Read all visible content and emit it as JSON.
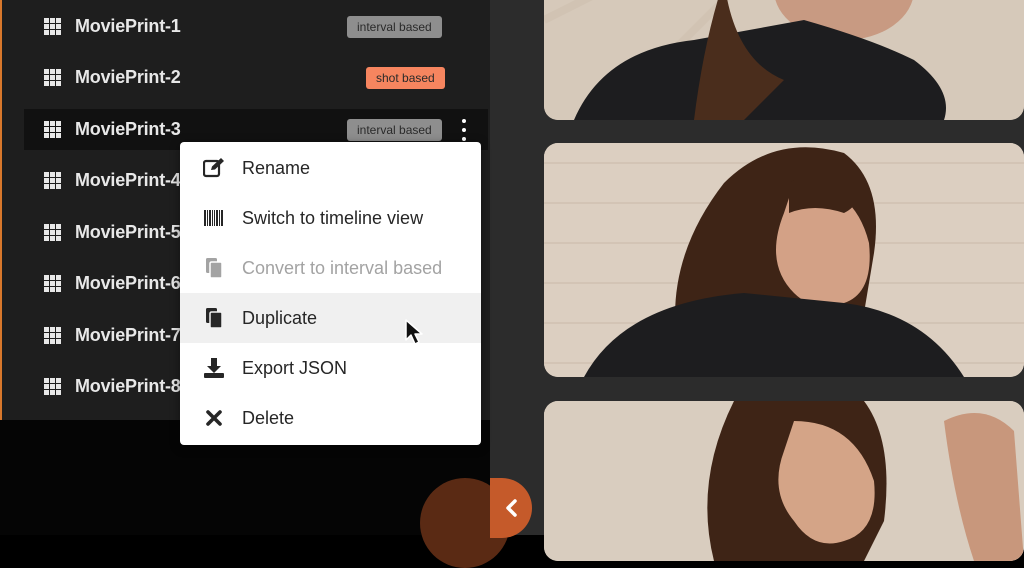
{
  "sidebar": {
    "items": [
      {
        "label": "MoviePrint-1",
        "badge": "interval based",
        "badge_type": "interval"
      },
      {
        "label": "MoviePrint-2",
        "badge": "shot based",
        "badge_type": "shot"
      },
      {
        "label": "MoviePrint-3",
        "badge": "interval based",
        "badge_type": "interval",
        "selected": true
      },
      {
        "label": "MoviePrint-4"
      },
      {
        "label": "MoviePrint-5"
      },
      {
        "label": "MoviePrint-6"
      },
      {
        "label": "MoviePrint-7"
      },
      {
        "label": "MoviePrint-8"
      }
    ]
  },
  "context_menu": {
    "items": [
      {
        "label": "Rename",
        "icon": "edit-icon"
      },
      {
        "label": "Switch to timeline view",
        "icon": "barcode-icon"
      },
      {
        "label": "Convert to interval based",
        "icon": "copy-icon",
        "disabled": true
      },
      {
        "label": "Duplicate",
        "icon": "duplicate-icon",
        "hovered": true
      },
      {
        "label": "Export JSON",
        "icon": "download-icon"
      },
      {
        "label": "Delete",
        "icon": "close-icon"
      }
    ]
  },
  "colors": {
    "accent": "#d8782c",
    "badge_interval": "#8e8e8e",
    "badge_shot": "#f6855f",
    "collapse_button": "#c55a2a"
  }
}
